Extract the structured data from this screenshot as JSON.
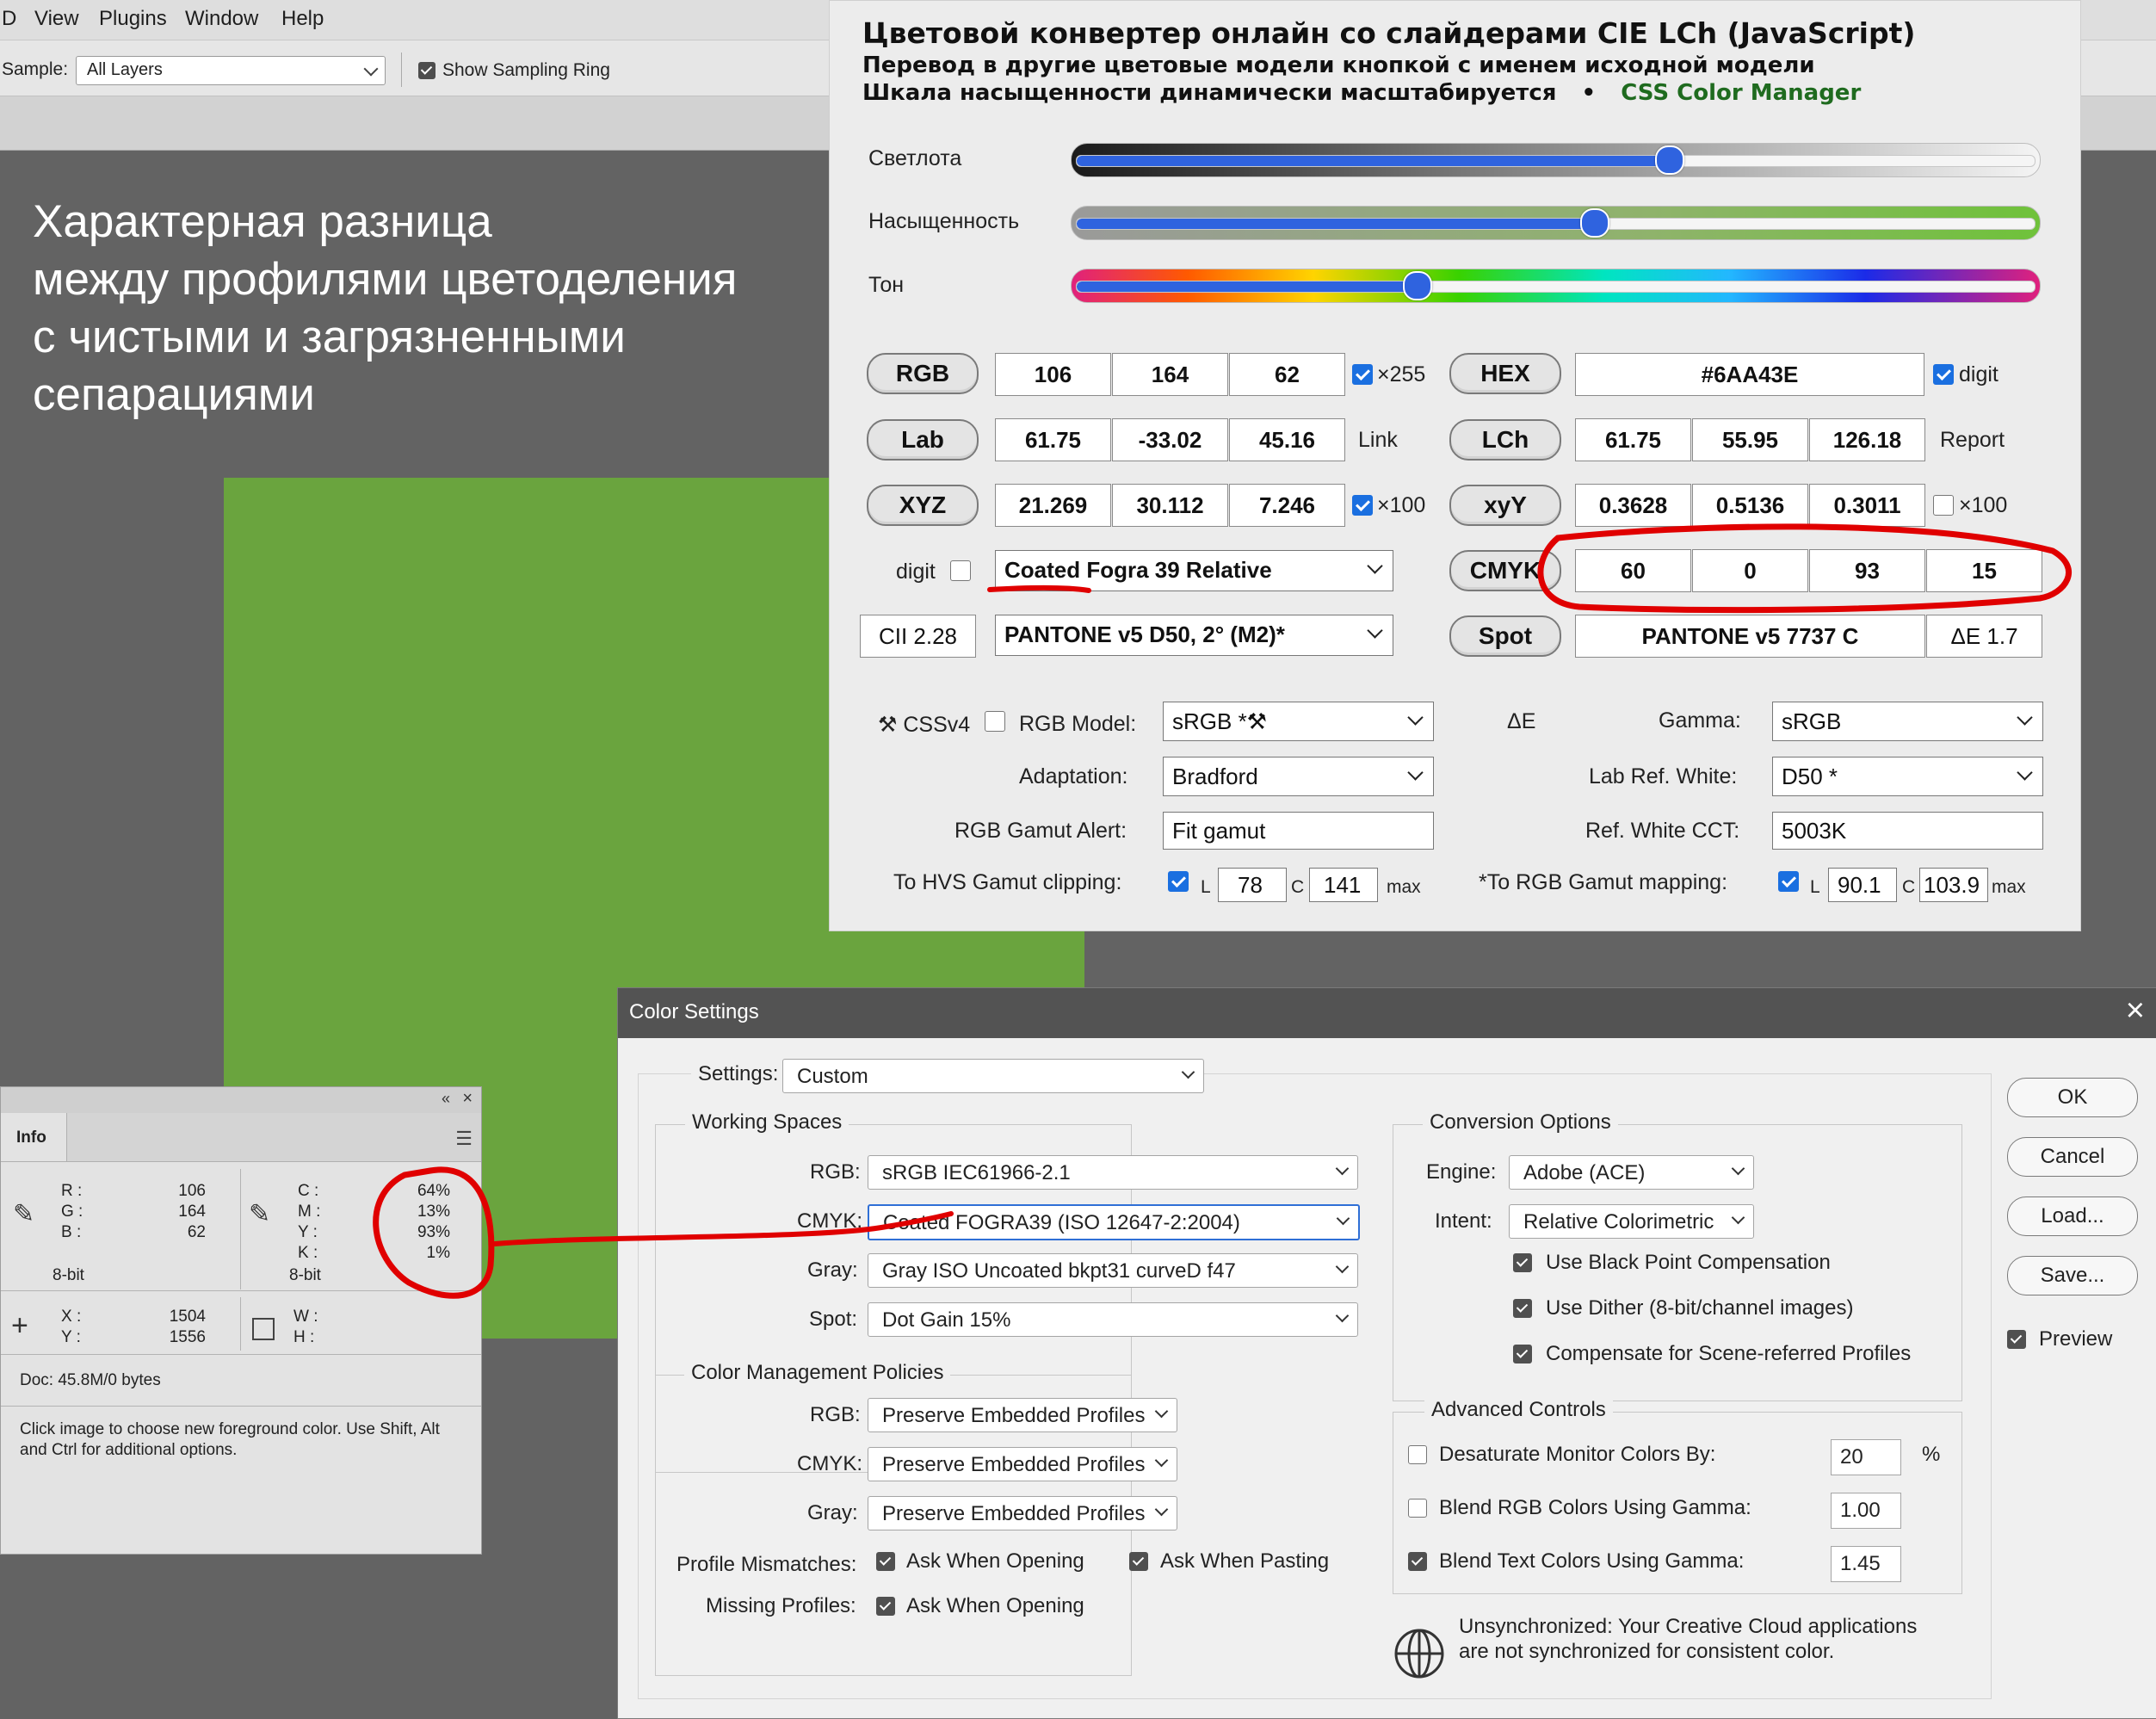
{
  "menubar": {
    "items": [
      "D",
      "View",
      "Plugins",
      "Window",
      "Help"
    ]
  },
  "optionsbar": {
    "sample_label": "Sample:",
    "sample_value": "All Layers",
    "show_sampling_ring": "Show Sampling Ring",
    "show_sampling_ring_checked": true
  },
  "heading": {
    "lines": [
      "Характерная разница",
      "между профилями цветоделения",
      "с чистыми и загрязненными",
      "сепарациями"
    ]
  },
  "swatch_color": "#6AA43E",
  "converter": {
    "title": "Цветовой конвертер онлайн со слайдерами CIE LCh (JavaScript)",
    "subtitle1": "Перевод в другие цветовые модели кнопкой с именем исходной модели",
    "subtitle2": "Шкала насыщенности динамически масштабируется",
    "bullet": "•",
    "manager_link": "CSS Color Manager",
    "sliders": [
      {
        "label": "Светлота",
        "value": 0.62
      },
      {
        "label": "Насыщенность",
        "value": 0.54
      },
      {
        "label": "Тон",
        "value": 0.35
      }
    ],
    "rgb": {
      "button": "RGB",
      "values": [
        "106",
        "164",
        "62"
      ],
      "scale": "×255",
      "scale_checked": true
    },
    "hex": {
      "button": "HEX",
      "value": "#6AA43E",
      "digit": "digit",
      "digit_checked": true
    },
    "lab": {
      "button": "Lab",
      "values": [
        "61.75",
        "-33.02",
        "45.16"
      ],
      "link": "Link"
    },
    "lch": {
      "button": "LCh",
      "values": [
        "61.75",
        "55.95",
        "126.18"
      ],
      "report": "Report"
    },
    "xyz": {
      "button": "XYZ",
      "values": [
        "21.269",
        "30.112",
        "7.246"
      ],
      "scale": "×100",
      "scale_checked": true
    },
    "xyy": {
      "button": "xyY",
      "values": [
        "0.3628",
        "0.5136",
        "0.3011"
      ],
      "scale": "×100",
      "scale_checked": false
    },
    "cmyk_row": {
      "digit": "digit",
      "digit_checked": false,
      "profile": "Coated Fogra 39 Relative",
      "button": "CMYK",
      "values": [
        "60",
        "0",
        "93",
        "15"
      ]
    },
    "spot_row": {
      "cii": "CII 2.28",
      "library": "PANTONE v5   D50, 2° (M2)*",
      "button": "Spot",
      "value": "PANTONE v5 7737 C",
      "delta": "ΔE 1.7"
    },
    "settings": {
      "cssv4": "⚒ CSSv4",
      "cssv4_checked": false,
      "rgb_model_label": "RGB Model:",
      "rgb_model": "sRGB *⚒",
      "delta_e": "ΔE",
      "gamma_label": "Gamma:",
      "gamma": "sRGB",
      "adaptation_label": "Adaptation:",
      "adaptation": "Bradford",
      "lab_ref_white_label": "Lab Ref. White:",
      "lab_ref_white": "D50 *",
      "gamut_alert_label": "RGB Gamut Alert:",
      "gamut_alert": "Fit gamut",
      "ref_white_cct_label": "Ref. White CCT:",
      "ref_white_cct": "5003K",
      "hvs_label": "To HVS Gamut clipping:",
      "hvs_checked": true,
      "hvs_l": "78",
      "hvs_c": "141",
      "rgb_mapping_label": "*To RGB Gamut mapping:",
      "rgb_mapping_checked": true,
      "map_l": "90.1",
      "map_c": "103.9",
      "l": "L",
      "c": "C",
      "max": "max"
    }
  },
  "info_panel": {
    "tab": "Info",
    "rgb_labels": [
      "R :",
      "G :",
      "B :"
    ],
    "rgb_values": [
      "106",
      "164",
      "62"
    ],
    "bitdepth": "8-bit",
    "cmyk_labels": [
      "C :",
      "M :",
      "Y :",
      "K :"
    ],
    "cmyk_values": [
      "64%",
      "13%",
      "93%",
      "1%"
    ],
    "bitdepth2": "8-bit",
    "xy_labels": [
      "X :",
      "Y :"
    ],
    "xy_values": [
      "1504",
      "1556"
    ],
    "wh_labels": [
      "W :",
      "H :"
    ],
    "doc": "Doc: 45.8M/0 bytes",
    "hint": "Click image to choose new foreground color.  Use Shift, Alt and Ctrl for additional options."
  },
  "color_settings": {
    "title": "Color Settings",
    "settings_label": "Settings:",
    "settings_value": "Custom",
    "working_spaces": {
      "title": "Working Spaces",
      "rows": [
        {
          "label": "RGB:",
          "value": "sRGB IEC61966-2.1"
        },
        {
          "label": "CMYK:",
          "value": "Coated FOGRA39 (ISO 12647-2:2004)"
        },
        {
          "label": "Gray:",
          "value": "Gray ISO Uncoated bkpt31 curveD f47"
        },
        {
          "label": "Spot:",
          "value": "Dot Gain 15%"
        }
      ]
    },
    "policies": {
      "title": "Color Management Policies",
      "rows": [
        {
          "label": "RGB:",
          "value": "Preserve Embedded Profiles"
        },
        {
          "label": "CMYK:",
          "value": "Preserve Embedded Profiles"
        },
        {
          "label": "Gray:",
          "value": "Preserve Embedded Profiles"
        }
      ],
      "mismatch_label": "Profile Mismatches:",
      "ask_opening": "Ask When Opening",
      "ask_pasting": "Ask When Pasting",
      "missing_label": "Missing Profiles:",
      "missing_ask_opening": "Ask When Opening"
    },
    "conversion": {
      "title": "Conversion Options",
      "engine_label": "Engine:",
      "engine": "Adobe (ACE)",
      "intent_label": "Intent:",
      "intent": "Relative Colorimetric",
      "bpc": "Use Black Point Compensation",
      "dither": "Use Dither (8-bit/channel images)",
      "scene": "Compensate for Scene-referred Profiles"
    },
    "advanced": {
      "title": "Advanced Controls",
      "desaturate": "Desaturate Monitor Colors By:",
      "desaturate_value": "20",
      "percent": "%",
      "desaturate_checked": false,
      "blend_rgb": "Blend RGB Colors Using Gamma:",
      "blend_rgb_value": "1.00",
      "blend_rgb_checked": false,
      "blend_text": "Blend Text Colors Using Gamma:",
      "blend_text_value": "1.45",
      "blend_text_checked": true
    },
    "sync_line1": "Unsynchronized: Your Creative Cloud applications",
    "sync_line2": "are not synchronized for consistent color.",
    "buttons": {
      "ok": "OK",
      "cancel": "Cancel",
      "load": "Load...",
      "save": "Save..."
    },
    "preview": "Preview",
    "preview_checked": true
  },
  "annotation_color": "#e00000"
}
